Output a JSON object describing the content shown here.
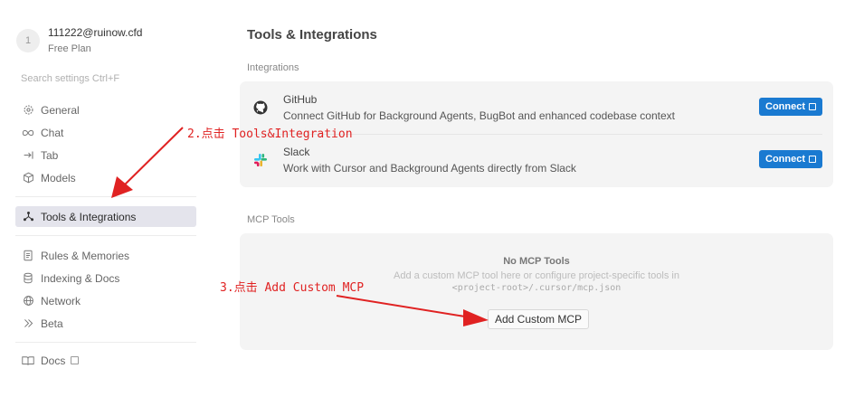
{
  "account": {
    "avatar_initial": "1",
    "email": "111222@ruinow.cfd",
    "plan": "Free Plan"
  },
  "sidebar": {
    "search_placeholder": "Search settings Ctrl+F",
    "items": [
      {
        "label": "General",
        "icon": "gear-icon"
      },
      {
        "label": "Chat",
        "icon": "infinity-icon"
      },
      {
        "label": "Tab",
        "icon": "arrow-to-line-icon"
      },
      {
        "label": "Models",
        "icon": "cube-icon"
      },
      {
        "label": "Tools & Integrations",
        "icon": "nodes-icon",
        "active": true
      },
      {
        "label": "Rules & Memories",
        "icon": "document-icon"
      },
      {
        "label": "Indexing & Docs",
        "icon": "database-icon"
      },
      {
        "label": "Network",
        "icon": "globe-icon"
      },
      {
        "label": "Beta",
        "icon": "double-chevron-icon"
      },
      {
        "label": "Docs",
        "icon": "book-icon"
      }
    ]
  },
  "main": {
    "title": "Tools & Integrations",
    "integrations_label": "Integrations",
    "integrations": [
      {
        "name": "GitHub",
        "description": "Connect GitHub for Background Agents, BugBot and enhanced codebase context",
        "button": "Connect",
        "icon": "github-icon"
      },
      {
        "name": "Slack",
        "description": "Work with Cursor and Background Agents directly from Slack",
        "button": "Connect",
        "icon": "slack-icon"
      }
    ],
    "mcp_label": "MCP Tools",
    "mcp": {
      "empty_title": "No MCP Tools",
      "empty_desc": "Add a custom MCP tool here or configure project-specific tools in",
      "path": "<project-root>/.cursor/mcp.json",
      "add_button": "Add Custom MCP"
    }
  },
  "annotations": {
    "step2": "2.点击 Tools&Integration",
    "step3": "3.点击 Add Custom MCP",
    "color": "#e02222"
  }
}
